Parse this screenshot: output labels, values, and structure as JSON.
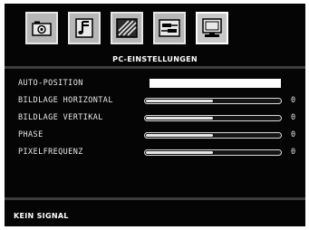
{
  "menu_title": "PC-EINSTELLUNGEN",
  "tabs": [
    {
      "icon": "camera-icon"
    },
    {
      "icon": "music-note-icon"
    },
    {
      "icon": "picture-icon"
    },
    {
      "icon": "connector-icon"
    },
    {
      "icon": "monitor-icon",
      "selected": true
    }
  ],
  "settings": {
    "auto_position": {
      "label": "AUTO-POSITION"
    },
    "horizontal": {
      "label": "BILDLAGE HORIZONTAL",
      "value": "0",
      "level": 0.5
    },
    "vertikal": {
      "label": "BILDLAGE VERTIKAL",
      "value": "0",
      "level": 0.5
    },
    "phase": {
      "label": "PHASE",
      "value": "0",
      "level": 0.5
    },
    "pixelfrequenz": {
      "label": "PIXELFREQUENZ",
      "value": "0",
      "level": 0.5
    }
  },
  "status_text": "KEIN SIGNAL",
  "colors": {
    "background": "#050505",
    "text": "#e8e8e8",
    "divider": "#3d3d3d"
  }
}
